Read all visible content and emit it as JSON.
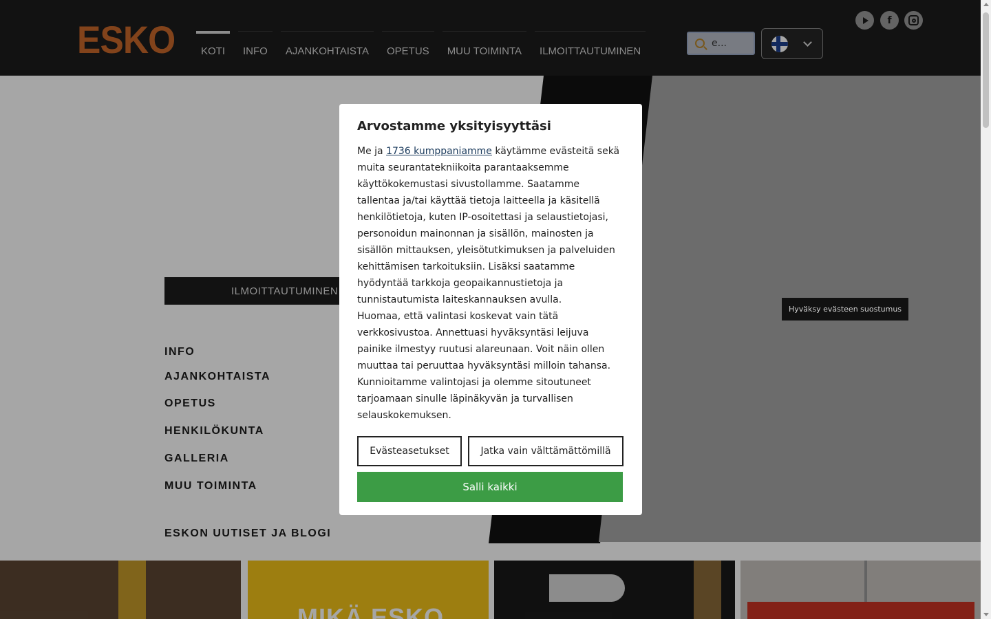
{
  "header": {
    "logo": "ESKO",
    "nav": [
      "KOTI",
      "INFO",
      "AJANKOHTAISTA",
      "OPETUS",
      "MUU TOIMINTA",
      "ILMOITTAUTUMINEN"
    ],
    "active_nav": "KOTI",
    "search_value": "e..."
  },
  "hero": {
    "register_button": "ILMOITTAUTUMINEN",
    "side_links": [
      "INFO",
      "AJANKOHTAISTA",
      "OPETUS",
      "HENKILÖKUNTA",
      "GALLERIA",
      "MUU TOIMINTA",
      "ESKON UUTISET JA BLOGI"
    ],
    "tile2_heading": "MIKÄ ESKO"
  },
  "cookie_chip": "Hyväksy evästeen suostumus",
  "modal": {
    "title": "Arvostamme yksityisyyttäsi",
    "intro": "Me ja ",
    "partners_link": "1736 kumppaniamme",
    "body1": " käytämme evästeitä sekä muita seurantatekniikoita parantaaksemme käyttökokemustasi sivustollamme. Saatamme tallentaa ja/tai käyttää tietoja laitteella ja käsitellä henkilötietoja, kuten IP-osoitettasi ja selaustietojasi, personoidun mainonnan ja sisällön, mainosten ja sisällön mittauksen, yleisötutkimuksen ja palveluiden kehittämisen tarkoituksiin. Lisäksi saatamme hyödyntää tarkkoja geopaikannustietoja ja tunnistautumista laiteskannauksen avulla.",
    "body2": "Huomaa, että valintasi koskevat vain tätä verkkosivustoa. Annettuasi hyväksyntäsi leijuva painike ilmestyy ruutusi alareunaan. Voit näin ollen muuttaa tai peruuttaa hyväksyntäsi milloin tahansa. Kunnioitamme valintojasi ja olemme sitoutuneet tarjoamaan sinulle läpinäkyvän ja turvallisen selauskokemuksen.",
    "btn_settings": "Evästeasetukset",
    "btn_necessary": "Jatka vain välttämättömillä",
    "btn_allow": "Salli kaikki"
  },
  "colors": {
    "header_bg": "#1c1c1c",
    "logo": "#c8672a",
    "allow_green": "#3c9c45"
  }
}
